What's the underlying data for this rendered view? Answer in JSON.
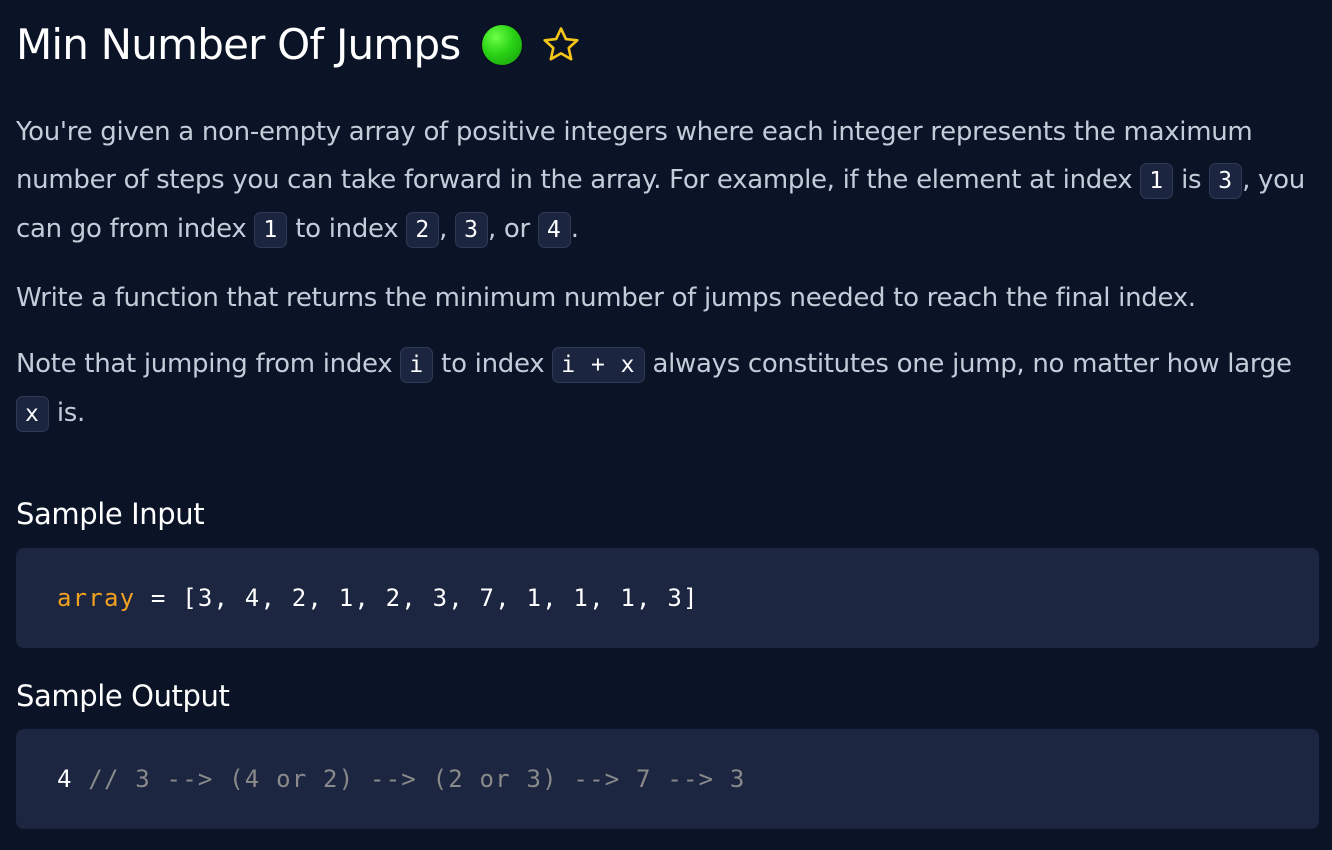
{
  "problem": {
    "title": "Min Number Of Jumps",
    "difficulty_color": "#2ad316",
    "star_color": "#f5c518"
  },
  "description": {
    "p1": {
      "t1": "You're given a non-empty array of positive integers where each integer represents the maximum number of steps you can take forward in the array. For example, if the element at index ",
      "c1": "1",
      "t2": " is ",
      "c2": "3",
      "t3": ", you can go from index ",
      "c3": "1",
      "t4": " to index ",
      "c4": "2",
      "t5": ", ",
      "c5": "3",
      "t6": ", or ",
      "c6": "4",
      "t7": "."
    },
    "p2": "Write a function that returns the minimum number of jumps needed to reach the final index.",
    "p3": {
      "t1": "Note that jumping from index ",
      "c1": "i",
      "t2": " to index ",
      "c2": "i + x",
      "t3": " always constitutes one jump, no matter how large ",
      "c3": "x",
      "t4": " is."
    }
  },
  "sample_input": {
    "heading": "Sample Input",
    "var": "array",
    "op": " = ",
    "value": "[3, 4, 2, 1, 2, 3, 7, 1, 1, 1, 3]"
  },
  "sample_output": {
    "heading": "Sample Output",
    "value": "4",
    "comment": " // 3 --> (4 or 2) --> (2 or 3) --> 7 --> 3"
  }
}
